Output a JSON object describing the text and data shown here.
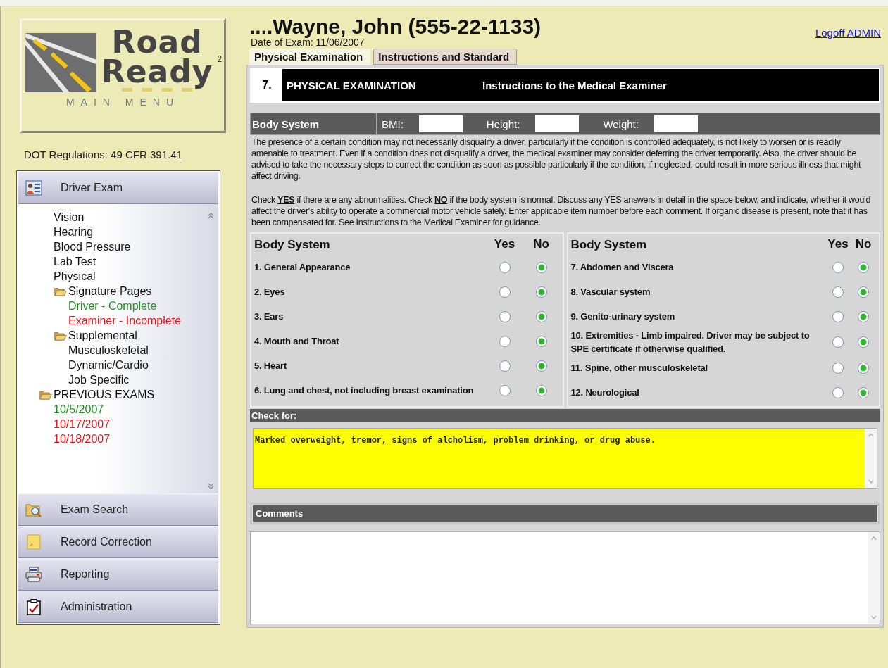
{
  "logo": {
    "line1": "Road",
    "line2": "Ready",
    "superscript": "2",
    "caption": "MAIN MENU"
  },
  "regulations": "DOT Regulations: 49 CFR 391.41",
  "nav": {
    "active": {
      "label": "Driver Exam"
    },
    "exam_sections": [
      {
        "label": "Vision"
      },
      {
        "label": "Hearing"
      },
      {
        "label": "Blood Pressure"
      },
      {
        "label": "Lab Test"
      },
      {
        "label": "Physical"
      },
      {
        "label": "Signature Pages",
        "children": [
          {
            "label": "Driver - Complete",
            "color": "#1f8f1f"
          },
          {
            "label": "Examiner - Incomplete",
            "color": "#e8141c"
          }
        ]
      },
      {
        "label": "Supplemental",
        "children": [
          {
            "label": "Musculoskeletal"
          },
          {
            "label": "Dynamic/Cardio"
          },
          {
            "label": "Job Specific"
          }
        ]
      }
    ],
    "previous_exams": {
      "label": "PREVIOUS EXAMS",
      "children": [
        {
          "label": "10/5/2007",
          "color": "#1f8f1f"
        },
        {
          "label": "10/17/2007",
          "color": "#e8141c"
        },
        {
          "label": "10/18/2007",
          "color": "#e8141c"
        }
      ]
    },
    "buttons": [
      {
        "label": "Exam Search",
        "kind": "search"
      },
      {
        "label": "Record Correction",
        "kind": "note"
      },
      {
        "label": "Reporting",
        "kind": "printer"
      },
      {
        "label": "Administration",
        "kind": "clipboard"
      }
    ]
  },
  "header": {
    "title": "....Wayne, John (555-22-1133)",
    "exam_date": "Date of Exam: 11/06/2007",
    "logoff": "Logoff ADMIN"
  },
  "tabs": [
    {
      "label": "Physical Examination",
      "selected": true
    },
    {
      "label": "Instructions and Standard",
      "selected": false
    }
  ],
  "section": {
    "number": "7.",
    "title": "PHYSICAL EXAMINATION",
    "subtitle": "Instructions to the Medical Examiner"
  },
  "measures": {
    "label": "Body System",
    "fields": [
      {
        "label": "BMI:"
      },
      {
        "label": "Height:"
      },
      {
        "label": "Weight:"
      }
    ]
  },
  "instructions": [
    "The presence of a certain condition may not necessarily disqualify a driver, particularly if the condition is controlled adequately, is not likely to worsen or is readily amenable to treatment. Even if a condition does not disqualify a driver, the medical examiner may consider deferring the driver temporarily. Also, the driver should be advised to take the necessary steps to correct the condition as soon as possible particularly if the condition, if neglected, could result in more serious illness that might affect driving.",
    "Check **YES** if there are any abnormalities. Check **NO** if the body system is normal. Discuss any YES answers in detail in the space below, and indicate, whether it would affect the driver's ability to operate a commercial motor vehicle safely. Enter applicable item number before each comment. If organic disease is present, note that it has been compensated for. See Instructions to the Medical Examiner for guidance."
  ],
  "checklist_panels": [
    {
      "columns": [
        "Body System",
        "Yes",
        "No"
      ],
      "rows": [
        {
          "label": "1. General Appearance",
          "answers": [
            {
              "selected": false
            },
            {
              "selected": true
            }
          ]
        },
        {
          "label": "2. Eyes",
          "answers": [
            {
              "selected": false
            },
            {
              "selected": true
            }
          ]
        },
        {
          "label": "3. Ears",
          "answers": [
            {
              "selected": false
            },
            {
              "selected": true
            }
          ]
        },
        {
          "label": "4. Mouth and Throat",
          "answers": [
            {
              "selected": false
            },
            {
              "selected": true
            }
          ]
        },
        {
          "label": "5. Heart",
          "answers": [
            {
              "selected": false
            },
            {
              "selected": true
            }
          ]
        },
        {
          "label": "6. Lung and chest, not including breast examination",
          "answers": [
            {
              "selected": false
            },
            {
              "selected": true
            }
          ]
        }
      ]
    },
    {
      "columns": [
        "Body System",
        "Yes",
        "No"
      ],
      "rows": [
        {
          "label": "7. Abdomen and Viscera",
          "answers": [
            {
              "selected": false
            },
            {
              "selected": true
            }
          ]
        },
        {
          "label": "8. Vascular system",
          "answers": [
            {
              "selected": false
            },
            {
              "selected": true
            }
          ]
        },
        {
          "label": "9. Genito-urinary system",
          "answers": [
            {
              "selected": false
            },
            {
              "selected": true
            }
          ]
        },
        {
          "label": "10. Extremities - Limb impaired. Driver may be subject to SPE certificate if otherwise qualified.",
          "answers": [
            {
              "selected": false
            },
            {
              "selected": true
            }
          ]
        },
        {
          "label": "11. Spine, other musculoskeletal",
          "answers": [
            {
              "selected": false
            },
            {
              "selected": true
            }
          ]
        },
        {
          "label": "12. Neurological",
          "answers": [
            {
              "selected": false
            },
            {
              "selected": true
            }
          ]
        }
      ]
    }
  ],
  "check_for": {
    "label": "Check for:",
    "text": "Marked overweight, tremor, signs of alcholism, problem drinking, or drug abuse."
  },
  "comments": {
    "label": "Comments"
  }
}
